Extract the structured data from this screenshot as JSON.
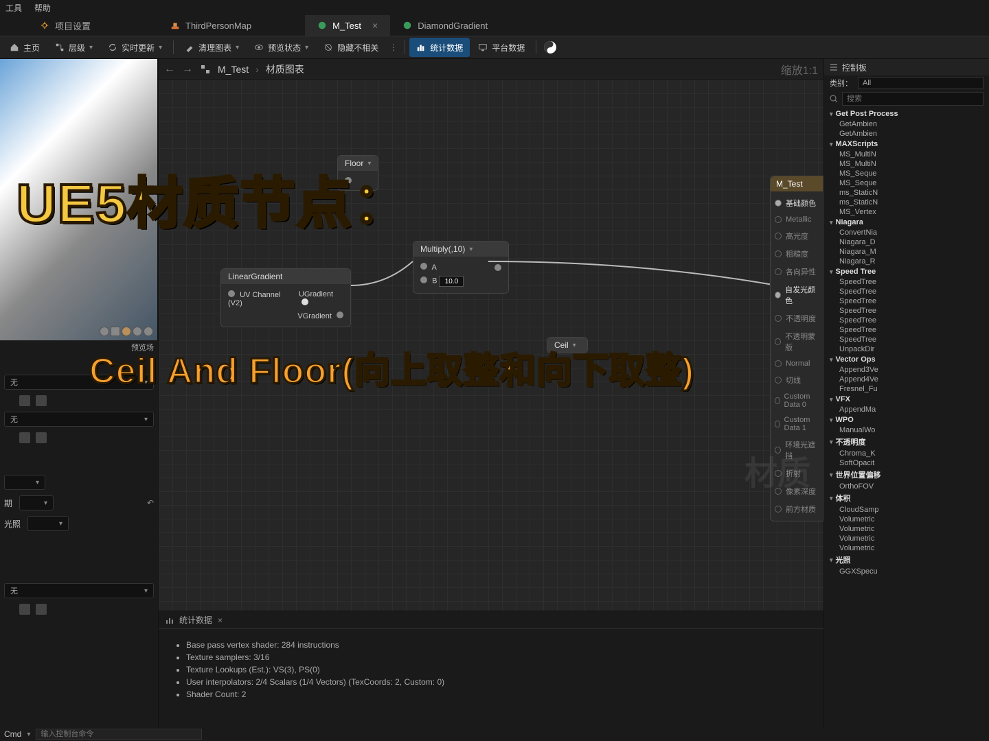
{
  "menubar": {
    "items": [
      "工具",
      "帮助"
    ]
  },
  "tabs": [
    {
      "label": "项目设置",
      "icon": "gear"
    },
    {
      "label": "ThirdPersonMap",
      "icon": "level"
    },
    {
      "label": "M_Test",
      "icon": "material",
      "active": true
    },
    {
      "label": "DiamondGradient",
      "icon": "material"
    }
  ],
  "toolbar": {
    "home": "主页",
    "level": "层级",
    "live": "实时更新",
    "clear": "清理图表",
    "preview": "预览状态",
    "hide": "隐藏不相关",
    "stats": "统计数据",
    "platform": "平台数据"
  },
  "breadcrumb": {
    "root": "M_Test",
    "sub": "材质图表",
    "zoom": "缩放1:1"
  },
  "preview_label": "预览场",
  "nodes": {
    "floor": {
      "title": "Floor"
    },
    "linear": {
      "title": "LinearGradient",
      "uv": "UV Channel (V2)",
      "u": "UGradient",
      "v": "VGradient"
    },
    "multiply": {
      "title": "Multiply(,10)",
      "a": "A",
      "b": "B",
      "bval": "10.0"
    },
    "ceil": {
      "title": "Ceil"
    }
  },
  "result": {
    "title": "M_Test",
    "pins": [
      "基础颜色",
      "Metallic",
      "高光度",
      "粗糙度",
      "各向异性",
      "自发光颜色",
      "不透明度",
      "不透明蒙版",
      "Normal",
      "切线",
      "Custom Data 0",
      "Custom Data 1",
      "环境光遮挡",
      "折射",
      "像素深度",
      "前方材质"
    ]
  },
  "palette": {
    "title": "控制板",
    "cat_label": "类别：",
    "cat_val": "All",
    "search": "搜索",
    "groups": [
      {
        "name": "Get Post Process",
        "items": [
          "GetAmbien",
          "GetAmbien"
        ]
      },
      {
        "name": "MAXScripts",
        "items": [
          "MS_MultiN",
          "MS_MultiN",
          "MS_Seque",
          "MS_Seque",
          "ms_StaticN",
          "ms_StaticN",
          "MS_Vertex"
        ]
      },
      {
        "name": "Niagara",
        "items": [
          "ConvertNia",
          "Niagara_D",
          "Niagara_M",
          "Niagara_R"
        ]
      },
      {
        "name": "Speed Tree",
        "items": [
          "SpeedTree",
          "SpeedTree",
          "SpeedTree",
          "SpeedTree",
          "SpeedTree",
          "SpeedTree",
          "SpeedTree",
          "UnpackDir"
        ]
      },
      {
        "name": "Vector Ops",
        "items": [
          "Append3Ve",
          "Append4Ve",
          "Fresnel_Fu"
        ]
      },
      {
        "name": "VFX",
        "items": [
          "AppendMa"
        ]
      },
      {
        "name": "WPO",
        "items": [
          "ManualWo"
        ]
      },
      {
        "name": "不透明度",
        "items": [
          "Chroma_K",
          "SoftOpacit"
        ]
      },
      {
        "name": "世界位置偏移",
        "items": [
          "OrthoFOV"
        ]
      },
      {
        "name": "体积",
        "items": [
          "CloudSamp",
          "Volumetric",
          "Volumetric",
          "Volumetric",
          "Volumetric"
        ]
      },
      {
        "name": "光照",
        "items": [
          "GGXSpecu"
        ]
      }
    ]
  },
  "stats": {
    "title": "统计数据",
    "lines": [
      "Base pass vertex shader: 284 instructions",
      "Texture samplers: 3/16",
      "Texture Lookups (Est.): VS(3), PS(0)",
      "User interpolators: 2/4 Scalars (1/4 Vectors) (TexCoords: 2, Custom: 0)",
      "Shader Count: 2"
    ]
  },
  "props": {
    "none": "无",
    "light": "光照",
    "period": "期"
  },
  "cmd": {
    "label": "Cmd",
    "placeholder": "输入控制台命令"
  },
  "overlay": {
    "title": "UE5材质节点：",
    "sub": "Ceil And Floor(向上取整和向下取整)",
    "watermark": "材质"
  }
}
